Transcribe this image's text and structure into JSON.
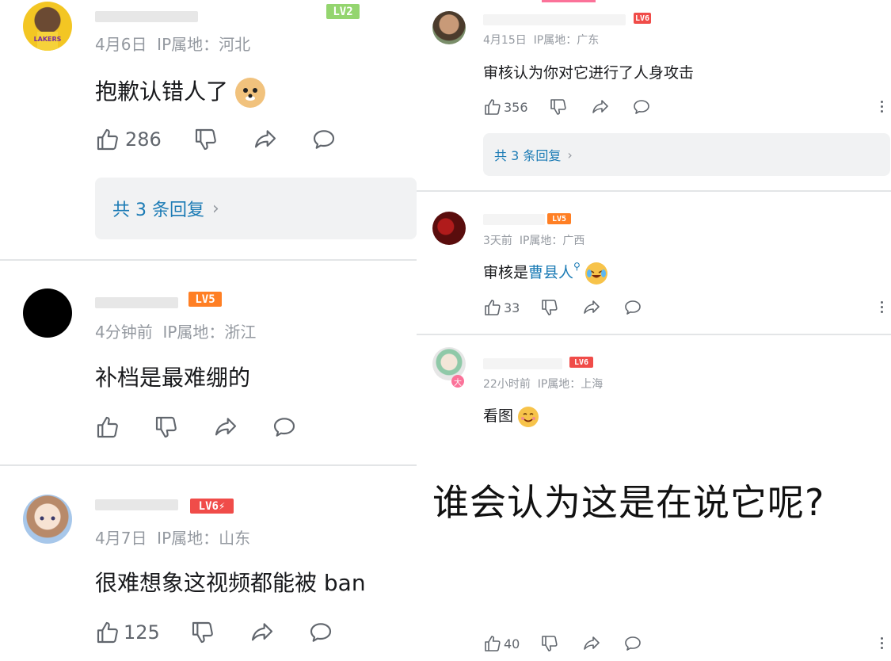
{
  "left": {
    "comments": [
      {
        "level": "LV2",
        "level_color": "#94d56f",
        "date": "4月6日",
        "ip": "IP属地：河北",
        "text": "抱歉认错人了",
        "likes": "286",
        "replies": "共 3 条回复"
      },
      {
        "level": "LV5",
        "level_color": "#ff7f24",
        "date": "4分钟前",
        "ip": "IP属地：浙江",
        "text": "补档是最难绷的",
        "likes": ""
      },
      {
        "level": "LV6⚡",
        "level_color": "#f04c49",
        "date": "4月7日",
        "ip": "IP属地：山东",
        "text": "很难想象这视频都能被 ban",
        "likes": "125"
      }
    ]
  },
  "right": {
    "comments": [
      {
        "level": "LV6",
        "level_color": "#f04c49",
        "date": "4月15日",
        "ip": "IP属地：广东",
        "text": "审核认为你对它进行了人身攻击",
        "likes": "356",
        "replies": "共 3 条回复"
      },
      {
        "level": "LV5",
        "level_color": "#ff7f24",
        "date": "3天前",
        "ip": "IP属地：广西",
        "text_prefix": "审核是",
        "text_link": "曹县人",
        "likes": "33"
      },
      {
        "level": "LV6",
        "level_color": "#f04c49",
        "date": "22小时前",
        "ip": "IP属地：上海",
        "text": "看图",
        "image_text": "谁会认为这是在说它呢?",
        "likes": "40",
        "badge": "大"
      }
    ]
  }
}
